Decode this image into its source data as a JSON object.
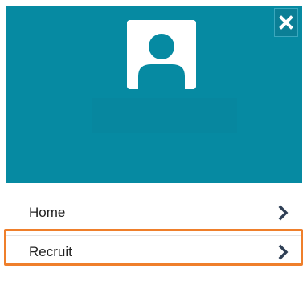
{
  "menu": {
    "items": [
      {
        "label": "Home",
        "icon": "chevron-right-icon"
      },
      {
        "label": "Recruit",
        "icon": "chevron-right-icon"
      }
    ]
  },
  "header": {
    "close_icon": "close-icon",
    "avatar_icon": "user-avatar-icon",
    "background_color": "#068aa2"
  },
  "highlight": {
    "color": "#ef7f2b"
  }
}
